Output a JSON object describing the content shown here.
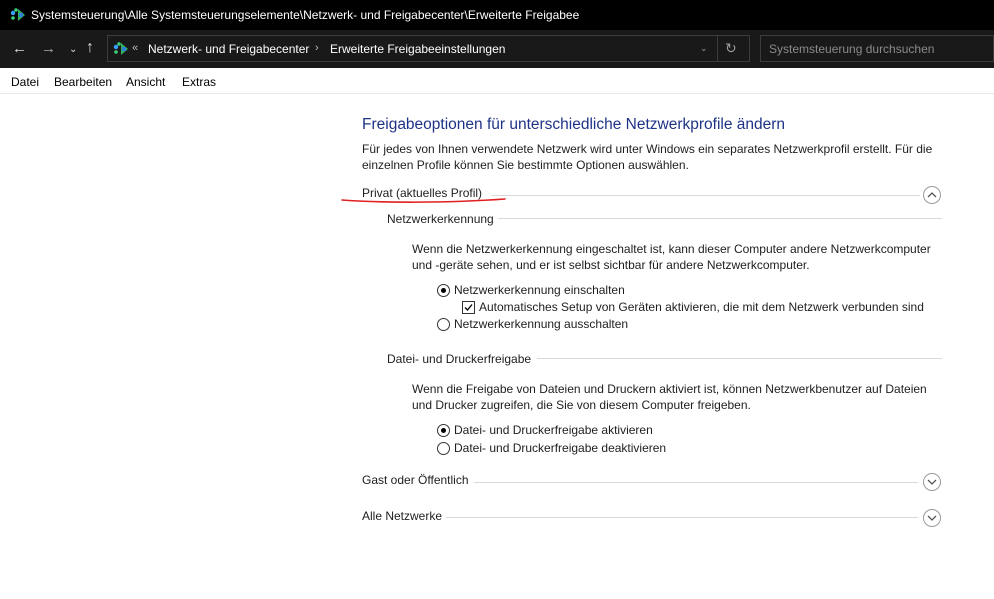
{
  "window": {
    "title": "Systemsteuerung\\Alle Systemsteuerungselemente\\Netzwerk- und Freigabecenter\\Erweiterte Freigabee"
  },
  "address": {
    "overflow": "«",
    "breadcrumb": [
      "Netzwerk- und Freigabecenter",
      "Erweiterte Freigabeeinstellungen"
    ],
    "separator": "›"
  },
  "search": {
    "placeholder": "Systemsteuerung durchsuchen"
  },
  "menu": [
    "Datei",
    "Bearbeiten",
    "Ansicht",
    "Extras"
  ],
  "main": {
    "title": "Freigabeoptionen für unterschiedliche Netzwerkprofile ändern",
    "intro": "Für jedes von Ihnen verwendete Netzwerk wird unter Windows ein separates Netzwerkprofil erstellt. Für die einzelnen Profile können Sie bestimmte Optionen auswählen.",
    "profiles": [
      {
        "label": "Privat (aktuelles Profil)",
        "expanded": true,
        "sections": [
          {
            "heading": "Netzwerkerkennung",
            "description": "Wenn die Netzwerkerkennung eingeschaltet ist, kann dieser Computer andere Netzwerkcomputer und -geräte sehen, und er ist selbst sichtbar für andere Netzwerkcomputer.",
            "options": [
              {
                "label": "Netzwerkerkennung einschalten",
                "checked": true
              },
              {
                "label": "Netzwerkerkennung ausschalten",
                "checked": false
              }
            ],
            "checkbox": {
              "label": "Automatisches Setup von Geräten aktivieren, die mit dem Netzwerk verbunden sind",
              "checked": true
            }
          },
          {
            "heading": "Datei- und Druckerfreigabe",
            "description": "Wenn die Freigabe von Dateien und Druckern aktiviert ist, können Netzwerkbenutzer auf Dateien und Drucker zugreifen, die Sie von diesem Computer freigeben.",
            "options": [
              {
                "label": "Datei- und Druckerfreigabe aktivieren",
                "checked": true
              },
              {
                "label": "Datei- und Druckerfreigabe deaktivieren",
                "checked": false
              }
            ]
          }
        ]
      },
      {
        "label": "Gast oder Öffentlich",
        "expanded": false
      },
      {
        "label": "Alle Netzwerke",
        "expanded": false
      }
    ]
  },
  "colors": {
    "title_blue": "#1e3287",
    "annotation_red": "#e02020",
    "titlebar_bg": "#000000",
    "addressbar_bg": "#191919"
  },
  "icons": {
    "app": "network-center-icon",
    "back": "arrow-left-icon",
    "forward": "arrow-right-icon",
    "history": "chevron-down-icon",
    "up": "arrow-up-icon",
    "refresh": "refresh-icon",
    "collapse": "chevron-up-circle-icon",
    "expand": "chevron-down-circle-icon"
  }
}
